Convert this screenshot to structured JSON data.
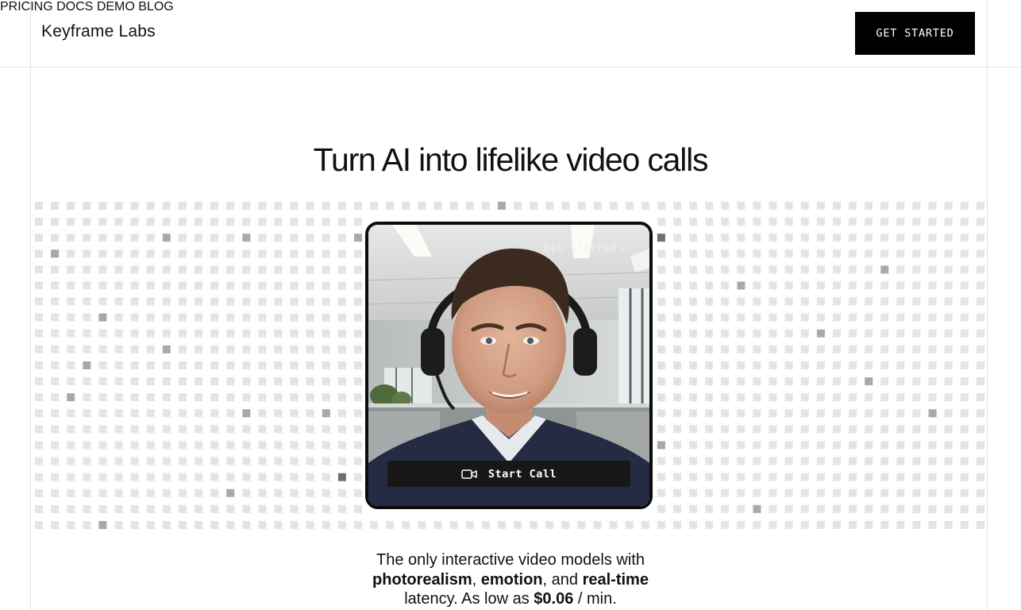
{
  "header": {
    "logo": "Keyframe Labs",
    "nav": [
      "PRICING",
      "DOCS",
      "DEMO",
      "BLOG"
    ],
    "cta": "GET STARTED"
  },
  "hero": {
    "headline": "Turn AI into lifelike video calls",
    "video": {
      "overlay_link": "Get started",
      "start_call": "Start Call"
    },
    "subtext": {
      "line1": "The only interactive video models with",
      "bold1": "photorealism",
      "sep1": ", ",
      "bold2": "emotion",
      "sep2": ", and ",
      "bold3": "real-time",
      "line3_pre": "latency. As low as ",
      "price": "$0.06",
      "line3_post": " / min."
    }
  },
  "colors": {
    "cta_bg": "#000000",
    "grid_light": "#e4e4e4",
    "grid_mid": "#a9a9a9",
    "grid_dark": "#6e6e6e"
  }
}
